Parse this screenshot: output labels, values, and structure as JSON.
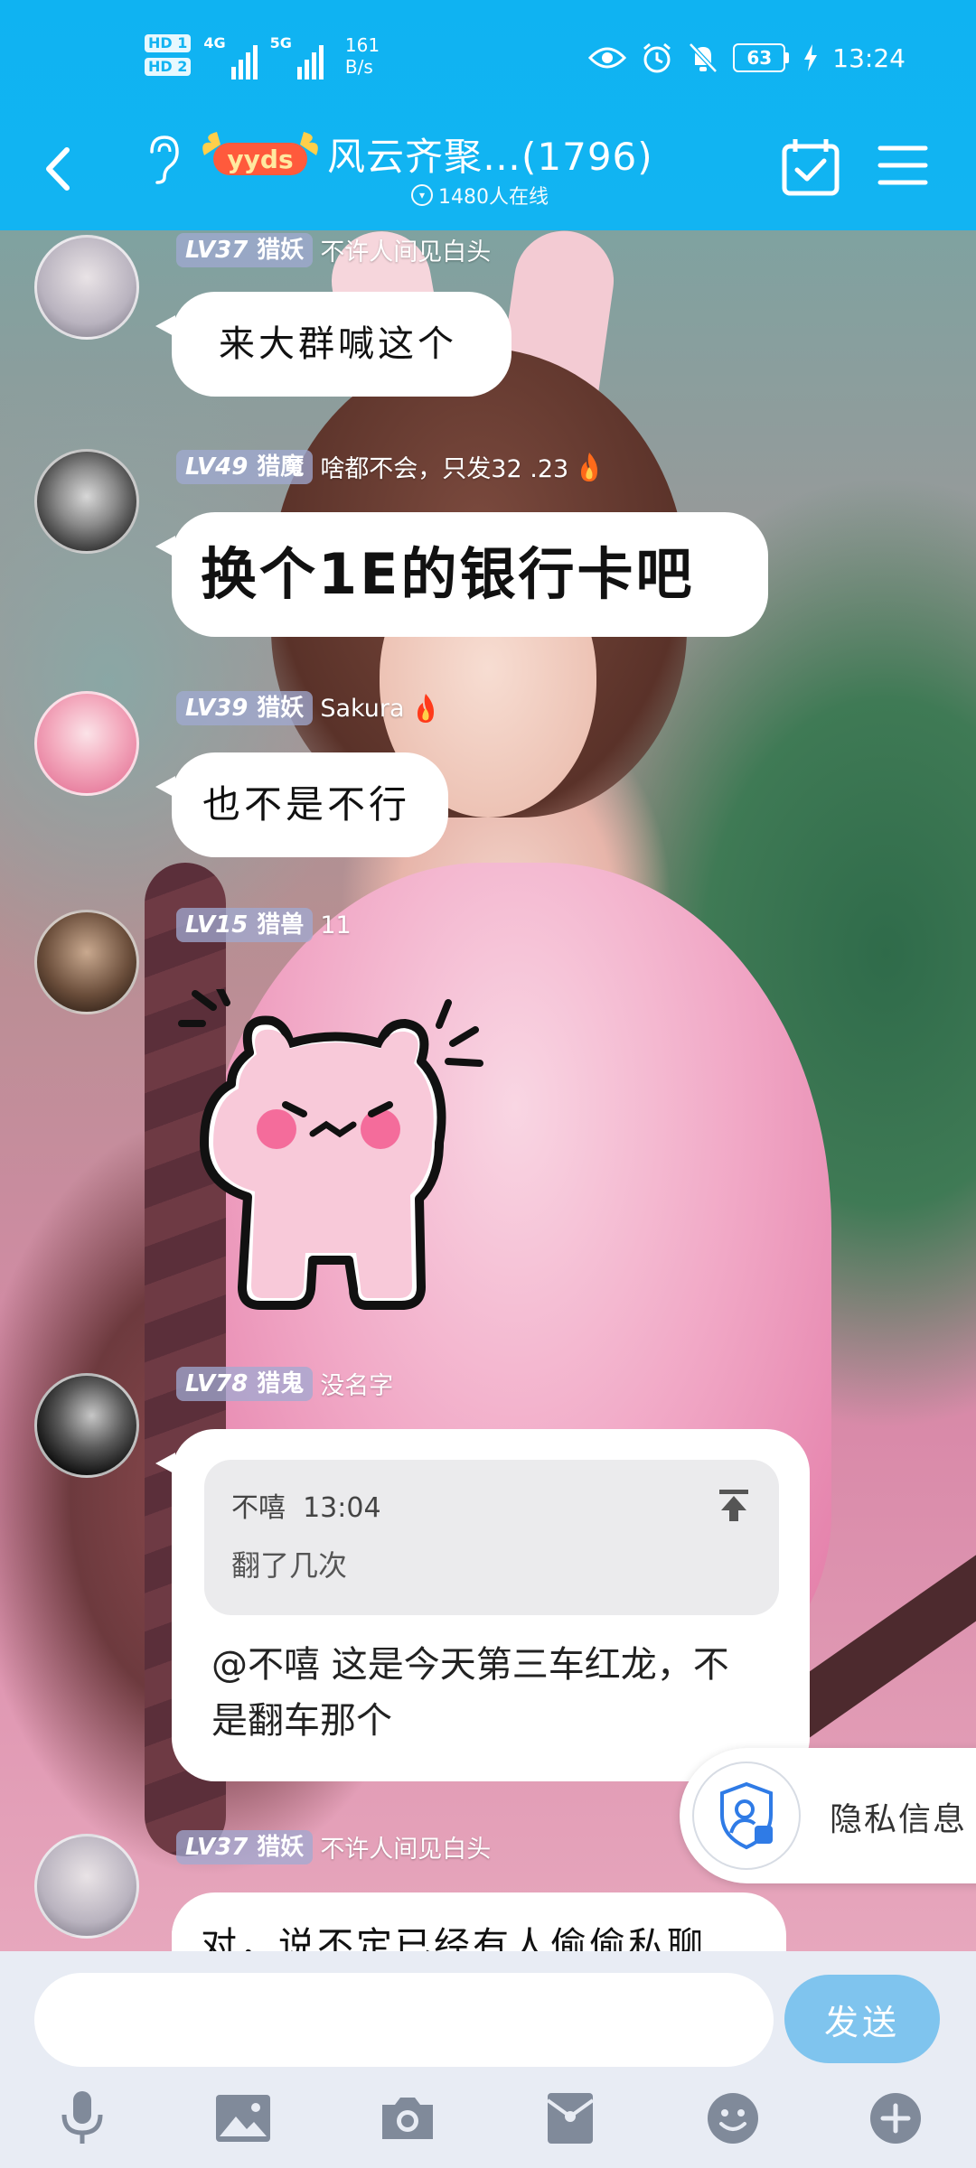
{
  "status_bar": {
    "hd1": "HD 1",
    "hd2": "HD 2",
    "net1": "4G",
    "net2": "5G",
    "speed_value": "161",
    "speed_unit": "B/s",
    "battery": "63",
    "time": "13:24"
  },
  "header": {
    "badge_text": "yyds",
    "title": "风云齐聚…(1796)",
    "online": "1480人在线"
  },
  "messages": [
    {
      "level": "LV37",
      "rank": "猎妖",
      "nick": "不许人间见白头",
      "text": "来大群喊这个"
    },
    {
      "level": "LV49",
      "rank": "猎魔",
      "nick": "啥都不会，只发32 .23",
      "text": "换个1E的银行卡吧"
    },
    {
      "level": "LV39",
      "rank": "猎妖",
      "nick": "Sakura",
      "text": "也不是不行"
    },
    {
      "level": "LV15",
      "rank": "猎兽",
      "nick": "11",
      "sticker": "angry-bear-sticker"
    },
    {
      "level": "LV78",
      "rank": "猎鬼",
      "nick": "没名字",
      "quote_author": "不嘻",
      "quote_time": "13:04",
      "quote_text": "翻了几次",
      "text": "@不嘻 这是今天第三车红龙，不是翻车那个"
    },
    {
      "level": "LV37",
      "rank": "猎妖",
      "nick": "不许人间见白头",
      "text": "对，说不定已经有人偷偷私聊"
    }
  ],
  "privacy": {
    "label": "隐私信息"
  },
  "input": {
    "send_label": "发送",
    "placeholder": ""
  },
  "colors": {
    "header": "#12b4f2",
    "send": "#7fc4ee",
    "badge": "#a0aad2"
  }
}
